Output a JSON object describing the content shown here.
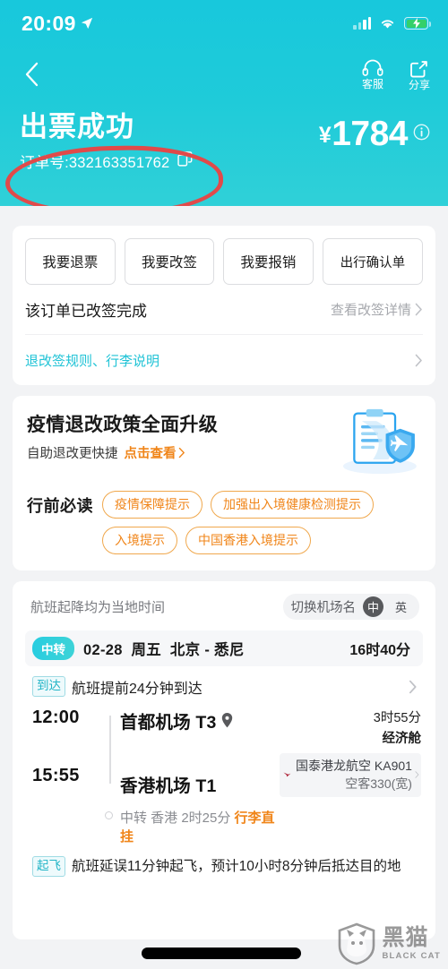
{
  "status_bar": {
    "time": "20:09",
    "location_icon": "location-arrow-icon",
    "signal_icon": "cellular-signal-icon",
    "wifi_icon": "wifi-icon",
    "battery_icon": "battery-charging-icon"
  },
  "nav": {
    "back_icon": "chevron-left-icon",
    "actions": [
      {
        "label": "客服",
        "icon": "headset-icon"
      },
      {
        "label": "分享",
        "icon": "share-icon"
      }
    ]
  },
  "hero": {
    "title": "出票成功",
    "order_label": "订单号:",
    "order_number": "332163351762",
    "copy_icon": "copy-icon",
    "currency": "¥",
    "price": "1784",
    "info_icon": "info-circle-icon",
    "annotation": "red-circle-highlight"
  },
  "actions_card": {
    "buttons": [
      {
        "label": "我要退票"
      },
      {
        "label": "我要改签"
      },
      {
        "label": "我要报销"
      },
      {
        "label": "出行确认单"
      }
    ],
    "rebook_status": "该订单已改签完成",
    "rebook_detail_link": "查看改签详情",
    "rules_link": "退改签规则、行李说明",
    "chevron_icon": "chevron-right-icon"
  },
  "policy_card": {
    "title": "疫情退改政策全面升级",
    "subtitle": "自助退改更快捷",
    "cta": "点击查看",
    "illustration_icon": "clipboard-shield-plane-icon",
    "tags_label": "行前必读",
    "tags": [
      "疫情保障提示",
      "加强出入境健康检测提示",
      "入境提示",
      "中国香港入境提示"
    ]
  },
  "flight_card": {
    "local_time_note": "航班起降均为当地时间",
    "switch_label": "切换机场名",
    "switch_options": [
      {
        "label": "中",
        "selected": true
      },
      {
        "label": "英",
        "selected": false
      }
    ],
    "trip": {
      "badge": "中转",
      "date": "02-28",
      "weekday": "周五",
      "route": "北京 - 悉尼",
      "duration": "16时40分"
    },
    "arrival_status": {
      "pill": "到达",
      "text": "航班提前24分钟到达",
      "chevron_icon": "chevron-right-icon"
    },
    "legs": {
      "depart_time": "12:00",
      "depart_airport": "首都机场 T3",
      "depart_pin_icon": "map-pin-icon",
      "arrive_time": "15:55",
      "arrive_airport": "香港机场 T1",
      "transfer_note_prefix": "中转 香港 2时25分 ",
      "transfer_note_highlight": "行李直挂",
      "flight_duration": "3时55分",
      "cabin": "经济舱",
      "airline_icon": "plane-icon",
      "airline": "国泰港龙航空 KA901",
      "aircraft": "空客330(宽)",
      "airline_chevron_icon": "chevron-right-icon"
    },
    "departure_status": {
      "pill": "起飞",
      "text": "航班延误11分钟起飞，预计10小时8分钟后抵达目的地"
    }
  },
  "watermark": {
    "cn": "黑猫",
    "en": "BLACK CAT",
    "icon": "black-cat-logo-icon"
  },
  "colors": {
    "hero_teal": "#1fcbd9",
    "accent_orange": "#f08519",
    "link_teal": "#20c3d6",
    "annotation_red": "#e04a4a"
  }
}
